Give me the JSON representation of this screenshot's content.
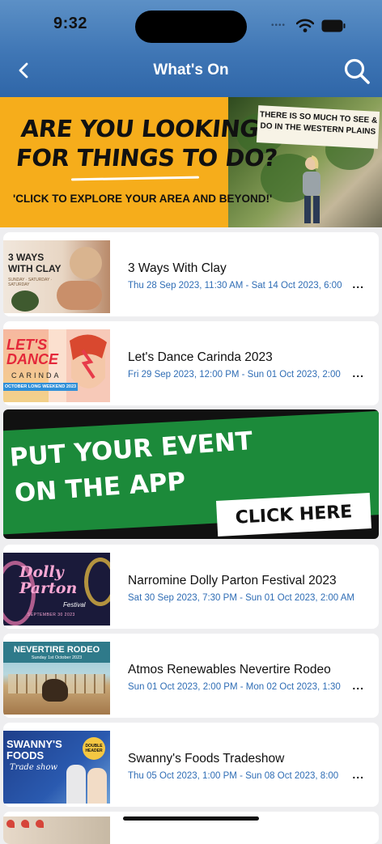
{
  "status": {
    "time": "9:32",
    "dots": "••••"
  },
  "nav": {
    "title": "What's On"
  },
  "banner": {
    "headline_line1": "ARE YOU LOOKING",
    "headline_line2": "FOR THINGS TO DO?",
    "cta": "'CLICK TO EXPLORE YOUR AREA AND BEYOND!'",
    "note": "THERE IS SO MUCH TO SEE & DO IN THE WESTERN PLAINS"
  },
  "events": [
    {
      "title": "3 Ways With Clay",
      "date": "Thu 28 Sep 2023, 11:30 AM - Sat 14 Oct 2023, 6:00",
      "thumb_text": "3 WAYS WITH CLAY",
      "thumb_sub": "SUNDAY · SATURDAY · SATURDAY"
    },
    {
      "title": "Let's Dance Carinda 2023",
      "date": "Fri 29 Sep 2023, 12:00 PM - Sun 01 Oct 2023, 2:00",
      "thumb_text": "LET'S DANCE",
      "thumb_sub": "CARINDA",
      "thumb_band": "OCTOBER LONG WEEKEND 2023"
    },
    {
      "title": "Narromine Dolly Parton Festival 2023",
      "date": "Sat 30 Sep 2023, 7:30 PM - Sun 01 Oct 2023, 2:00 AM",
      "thumb_text": "Dolly Parton",
      "thumb_sub": "Festival",
      "thumb_band": "SEPTEMBER 30 2023"
    },
    {
      "title": "Atmos Renewables Nevertire Rodeo",
      "date": "Sun 01 Oct 2023, 2:00 PM - Mon 02 Oct 2023, 1:30",
      "thumb_text": "NEVERTIRE RODEO",
      "thumb_sub": "Sunday 1st October 2023"
    },
    {
      "title": "Swanny's Foods Tradeshow",
      "date": "Thu 05 Oct 2023, 1:00 PM - Sun 08 Oct 2023, 8:00",
      "thumb_text": "SWANNY'S FOODS",
      "thumb_sub": "Trade show",
      "thumb_badge": "DOUBLE HEADER"
    }
  ],
  "more_label": "...",
  "promo": {
    "line1": "PUT YOUR EVENT",
    "line2": "ON THE APP",
    "button": "CLICK HERE"
  },
  "colors": {
    "header": "#3f76b5",
    "accent": "#2f6db5",
    "banner": "#f6ad1b",
    "promo_green": "#1c8a3a"
  }
}
